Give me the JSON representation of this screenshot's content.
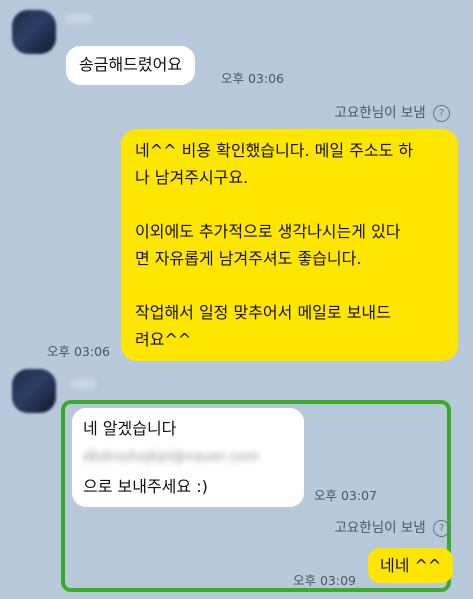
{
  "messages": {
    "m1": {
      "text": "송금해드렸어요",
      "time": "오후 03:06"
    },
    "sender_label": "고요한님이 보냄",
    "help_glyph": "?",
    "m2": {
      "lines": [
        "네^^ 비용 확인했습니다. 메일 주소도 하",
        "나 남겨주시구요.",
        "",
        "이외에도 추가적으로 생각나시는게 있다",
        "면 자유롭게 남겨주셔도 좋습니다.",
        "",
        "작업해서 일정 맞추어서 메일로 보내드",
        "려요^^"
      ],
      "time": "오후 03:06"
    },
    "m3": {
      "line1": "네 알겠습니다",
      "email_blurred": "dkdrsshojkpi@naver.com",
      "line3": "으로 보내주세요 :)",
      "time": "오후 03:07"
    },
    "m4": {
      "text": "네네 ^^",
      "time": "오후 03:09"
    }
  }
}
